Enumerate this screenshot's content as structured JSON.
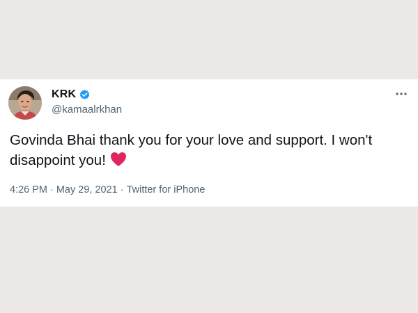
{
  "tweet": {
    "author": {
      "display_name": "KRK",
      "handle": "@kamaalrkhan",
      "verified": true,
      "avatar_icon": "profile-photo"
    },
    "text": "Govinda Bhai thank you for your love and support. I won't disappoint you!",
    "emoji": "red-heart",
    "time": "4:26 PM",
    "date": "May 29, 2021",
    "source": "Twitter for iPhone",
    "separator": "·"
  },
  "colors": {
    "page_background": "#ece8e8",
    "card_background": "#ffffff",
    "verified_blue": "#1d9bf0",
    "heart_red": "#e0245e",
    "text_primary": "#0f1419",
    "text_secondary": "#536471"
  },
  "icons": {
    "verified": "verified-badge-icon",
    "more": "more-options-icon",
    "heart": "red-heart-icon"
  }
}
